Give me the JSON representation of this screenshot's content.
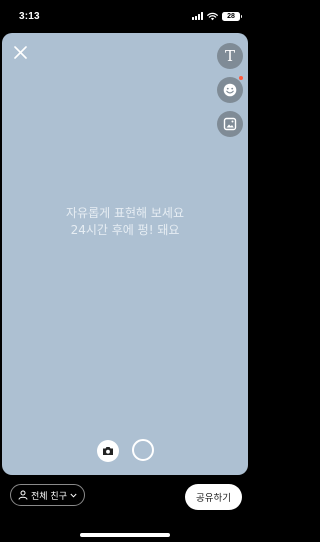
{
  "status_bar": {
    "time": "3:13",
    "battery": "28"
  },
  "canvas": {
    "background_color": "#adc0d2",
    "prompt_line1": "자유롭게 표현해 보세요",
    "prompt_line2": "24시간 후에 펑! 돼요"
  },
  "tools": [
    {
      "name": "text-tool",
      "icon": "T"
    },
    {
      "name": "sticker-tool",
      "icon": "smiley-icon",
      "has_new_dot": true
    },
    {
      "name": "photo-tool",
      "icon": "photo-sticker-icon"
    }
  ],
  "bottom_bar": {
    "audience_label": "전체 친구",
    "share_label": "공유하기"
  }
}
